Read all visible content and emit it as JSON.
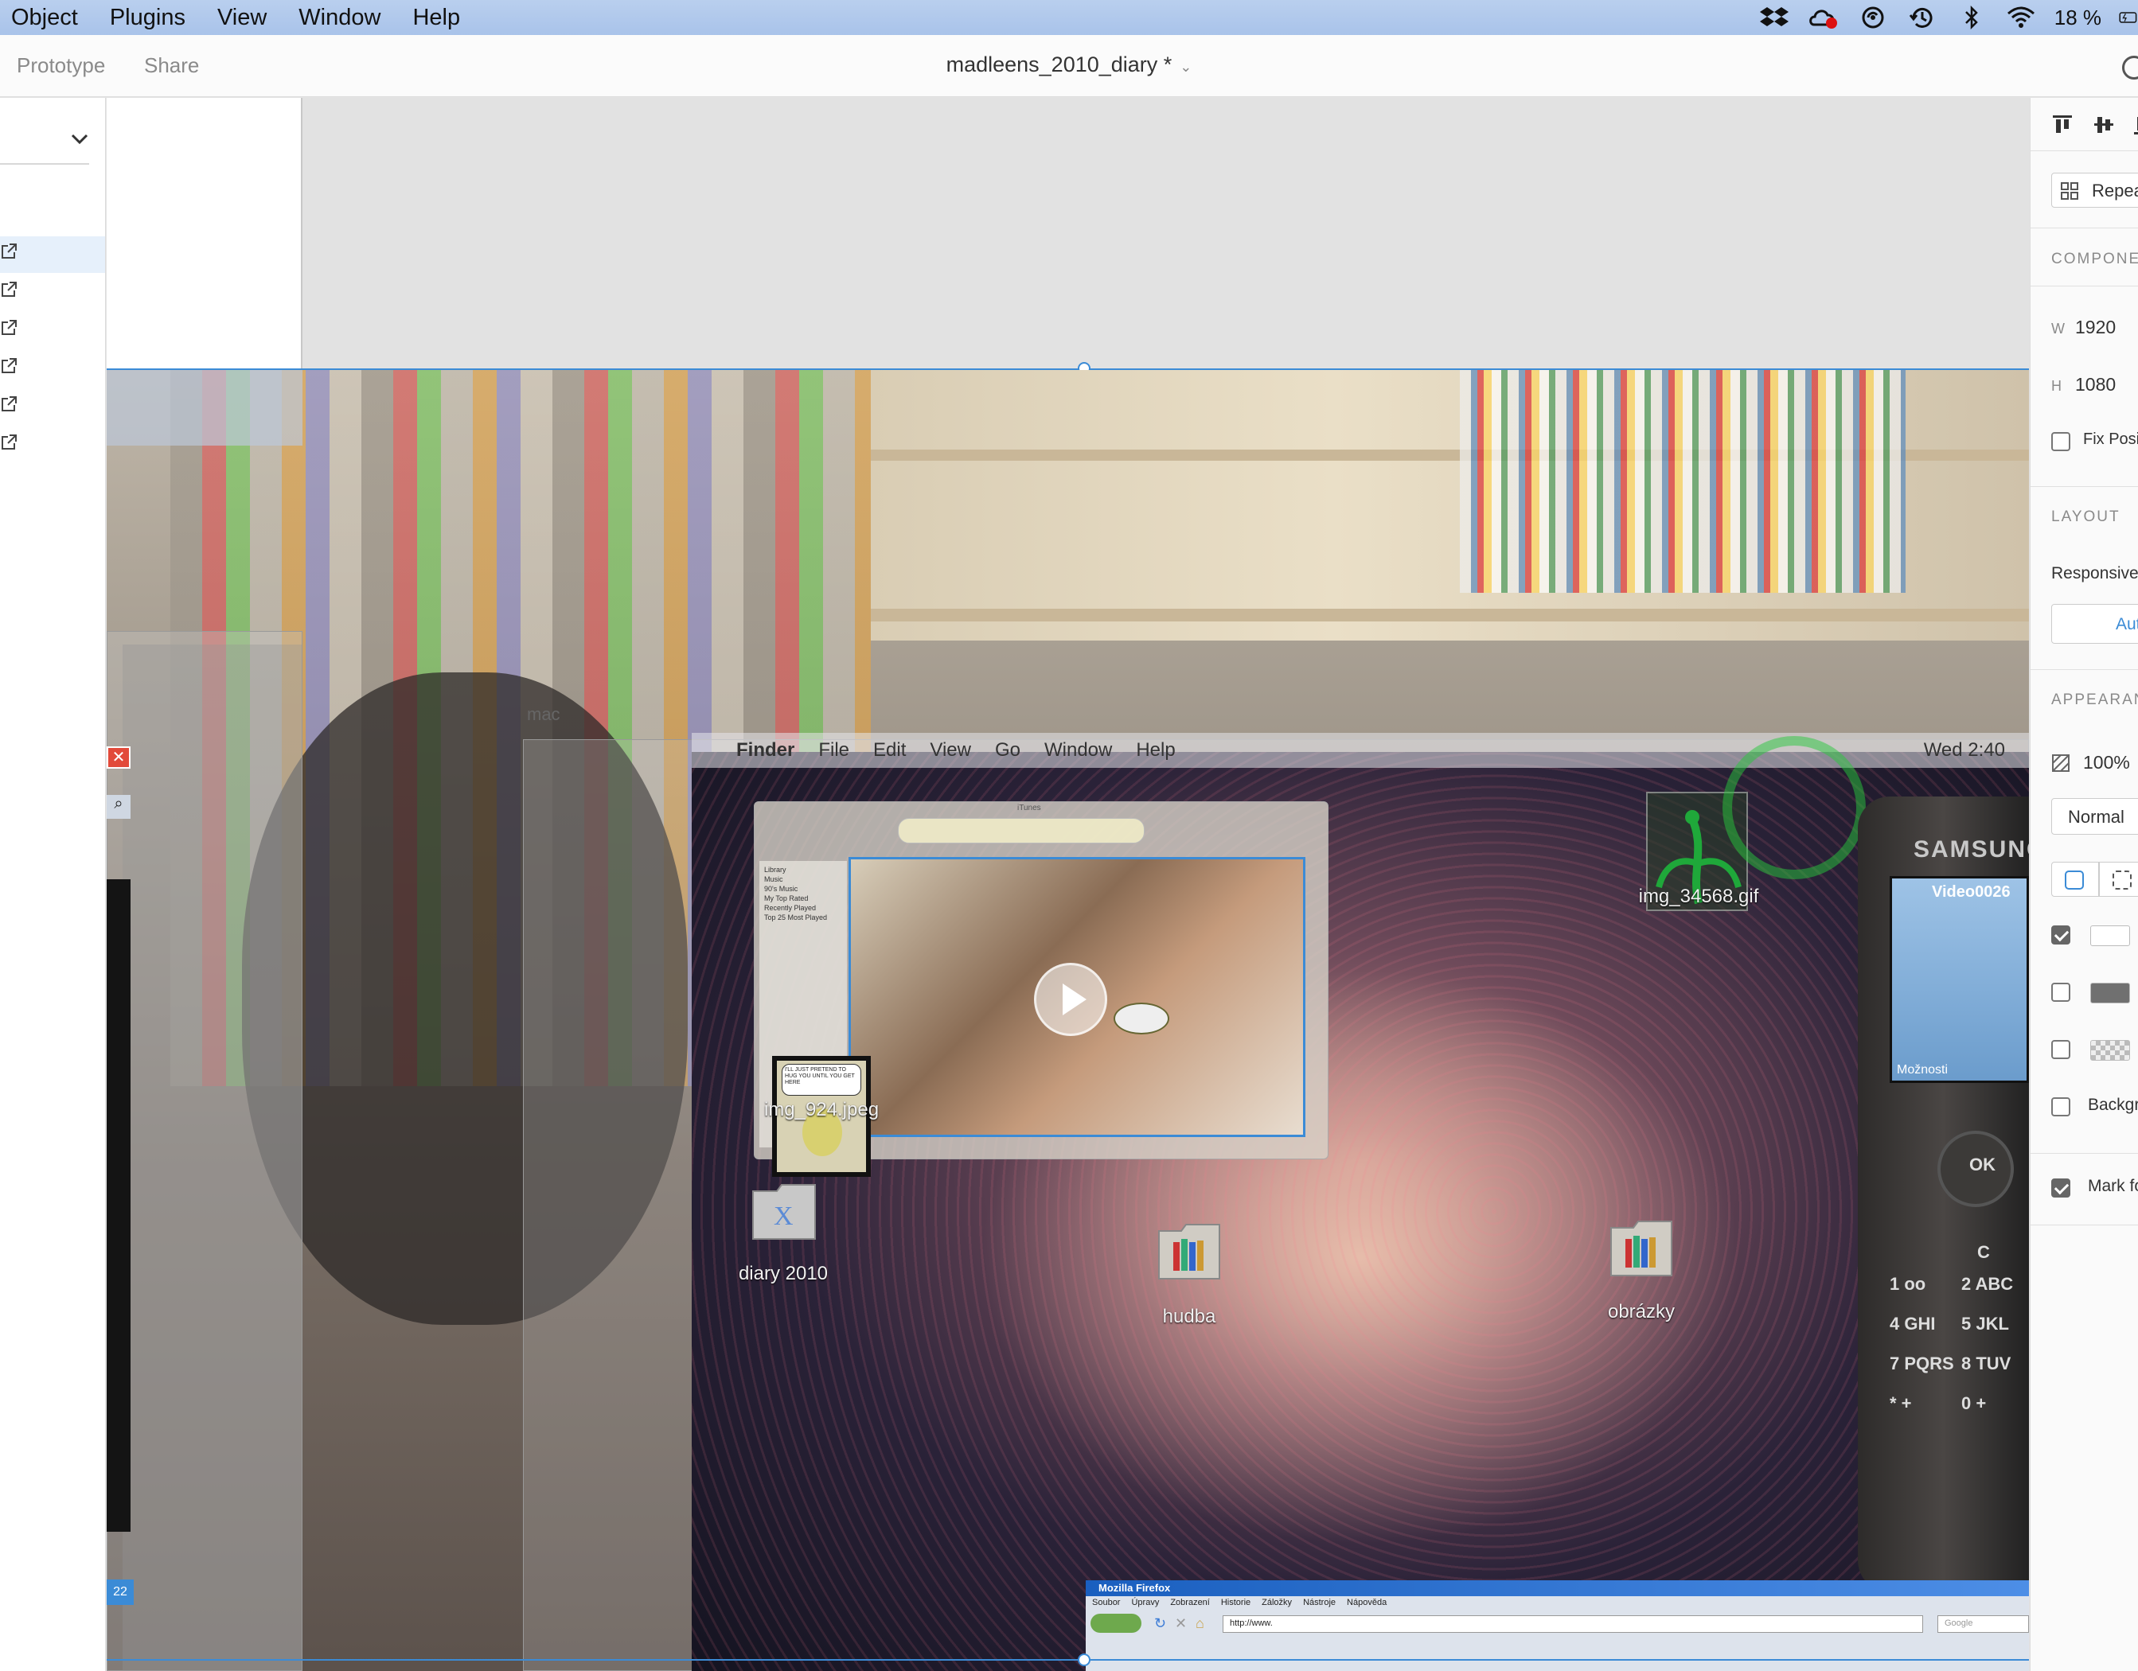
{
  "menubar": {
    "items": [
      "Object",
      "Plugins",
      "View",
      "Window",
      "Help"
    ],
    "battery": "18 %",
    "icons": [
      "dropbox-icon",
      "creative-cloud-icon",
      "sync-icon",
      "time-machine-icon",
      "bluetooth-icon",
      "wifi-icon",
      "battery-icon"
    ]
  },
  "toolbar": {
    "tabs": [
      "Prototype",
      "Share"
    ],
    "document_title": "madleens_2010_diary *"
  },
  "canvas": {
    "label_mac": "mac",
    "desktop_menubar": {
      "items": [
        "Finder",
        "File",
        "Edit",
        "View",
        "Go",
        "Window",
        "Help"
      ],
      "clock": "Wed 2:40"
    },
    "itunes": {
      "title": "iTunes",
      "sidebar_items": [
        "Library",
        "Music",
        "90's Music",
        "My Top Rated",
        "Recently Played",
        "Top 25 Most Played"
      ]
    },
    "desktop_icons": [
      {
        "label": "img_34568.gif",
        "icon": "gif-image-icon"
      },
      {
        "label": "img_924.jpeg",
        "icon": "jpeg-image-icon"
      },
      {
        "label": "diary 2010",
        "icon": "folder-icon"
      },
      {
        "label": "hudba",
        "icon": "folder-icon"
      },
      {
        "label": "obrázky",
        "icon": "folder-icon"
      }
    ],
    "comic_text": "I'LL JUST PRETEND TO HUG YOU UNTIL YOU GET HERE",
    "phone": {
      "brand": "SAMSUNG",
      "screen_title": "Video0026",
      "screen_footer": "Možnosti",
      "keys": [
        "1 oo",
        "2 ABC",
        "4 GHI",
        "5 JKL",
        "7 PQRS",
        "8 TUV",
        "* +",
        "0 +",
        "C",
        "OK"
      ]
    },
    "firefox": {
      "title": "Mozilla Firefox",
      "menu": [
        "Soubor",
        "Úpravy",
        "Zobrazení",
        "Historie",
        "Záložky",
        "Nástroje",
        "Nápověda"
      ],
      "url": "http://www.",
      "search": "Google"
    },
    "left_badge": "22"
  },
  "rightpanel": {
    "repeat_grid": "Repeat Grid",
    "component_label": "COMPONENT",
    "width_label": "W",
    "width_value": "1920",
    "height_label": "H",
    "height_value": "1080",
    "fix_position": "Fix Position",
    "layout_label": "LAYOUT",
    "responsive": "Responsive",
    "auto": "Auto",
    "appearance_label": "APPEARANCE",
    "opacity": "100%",
    "blend_mode": "Normal",
    "fill_checked": true,
    "border_checked": false,
    "shadow_checked": false,
    "background_blur": "Background Blur",
    "mark_for_export": "Mark for Export"
  },
  "colors": {
    "selection_blue": "#3b8bd6",
    "menubar_blue": "#b0c8ec",
    "firefox_blue": "#1a5fbf"
  }
}
